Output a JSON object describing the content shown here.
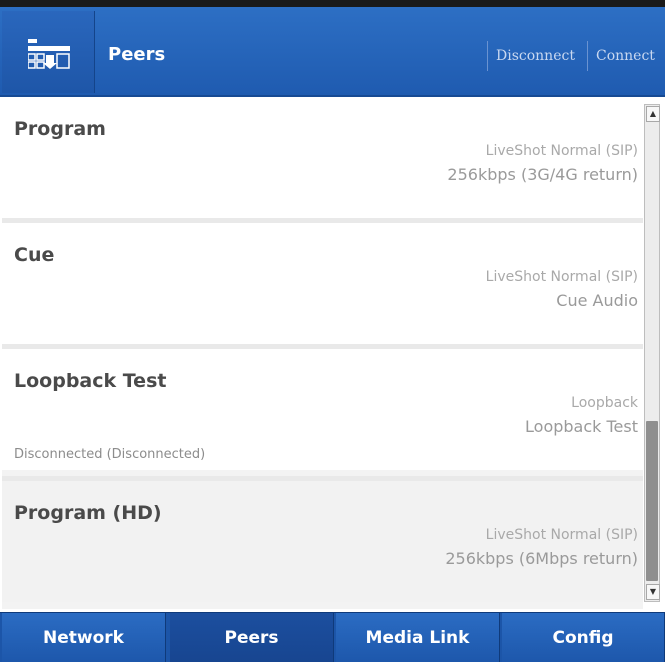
{
  "header": {
    "title": "Peers",
    "disconnect_label": "Disconnect",
    "connect_label": "Connect",
    "logo_icon": "peers-logo-icon"
  },
  "peers": [
    {
      "name": "Program",
      "type": "LiveShot Normal (SIP)",
      "desc": "256kbps (3G/4G return)",
      "status": ""
    },
    {
      "name": "Cue",
      "type": "LiveShot Normal (SIP)",
      "desc": "Cue Audio",
      "status": ""
    },
    {
      "name": "Loopback Test",
      "type": "Loopback",
      "desc": "Loopback Test",
      "status": "Disconnected (Disconnected)"
    },
    {
      "name": "Program (HD)",
      "type": "LiveShot Normal (SIP)",
      "desc": "256kbps (6Mbps return)",
      "status": ""
    }
  ],
  "scrollbar": {
    "up_icon": "scroll-up-arrow-icon",
    "down_icon": "scroll-down-arrow-icon"
  },
  "nav": {
    "tabs": [
      {
        "label": "Network"
      },
      {
        "label": "Peers"
      },
      {
        "label": "Media Link"
      },
      {
        "label": "Config"
      }
    ],
    "active": "Peers"
  },
  "colors": {
    "header_blue": "#2d6fc4",
    "nav_blue": "#1c55a8",
    "text_gray": "#4a4a4a"
  }
}
